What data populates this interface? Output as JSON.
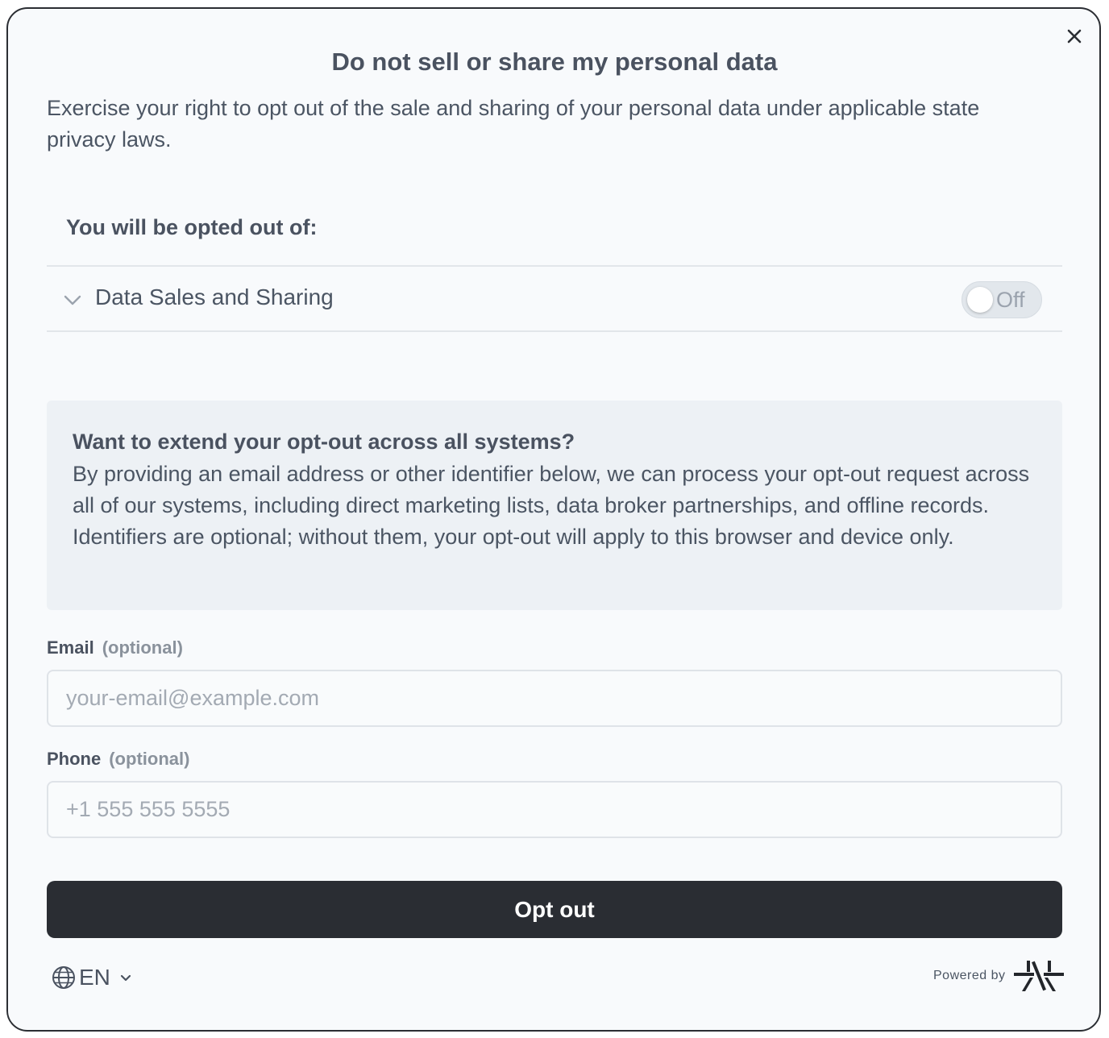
{
  "modal": {
    "title": "Do not sell or share my personal data",
    "intro": "Exercise your right to opt out of the sale and sharing of your personal data under applicable state privacy laws.",
    "close_icon": "close-icon"
  },
  "opt_out_section": {
    "heading": "You will be opted out of:",
    "purposes": [
      {
        "label": "Data Sales and Sharing",
        "toggle_label": "Off",
        "toggle_on": false
      }
    ]
  },
  "info_box": {
    "title": "Want to extend your opt-out across all systems?",
    "body": "By providing an email address or other identifier below, we can process your opt-out request across all of our systems, including direct marketing lists, data broker partnerships, and offline records. Identifiers are optional; without them, your opt-out will apply to this browser and device only."
  },
  "form": {
    "email": {
      "label": "Email",
      "optional_text": "(optional)",
      "placeholder": "your-email@example.com",
      "value": ""
    },
    "phone": {
      "label": "Phone",
      "optional_text": "(optional)",
      "placeholder": "+1 555 555 5555",
      "value": ""
    },
    "submit_label": "Opt out"
  },
  "footer": {
    "language": "EN",
    "language_icon": "globe-icon",
    "powered_by": "Powered by",
    "logo_icon": "brand-logo-icon"
  },
  "colors": {
    "modal_bg": "#f8fafc",
    "text": "#4b5563",
    "heading": "#4a5260",
    "button_bg": "#2a2d33",
    "info_bg": "#edf1f5",
    "toggle_bg": "#e2e7ec"
  }
}
